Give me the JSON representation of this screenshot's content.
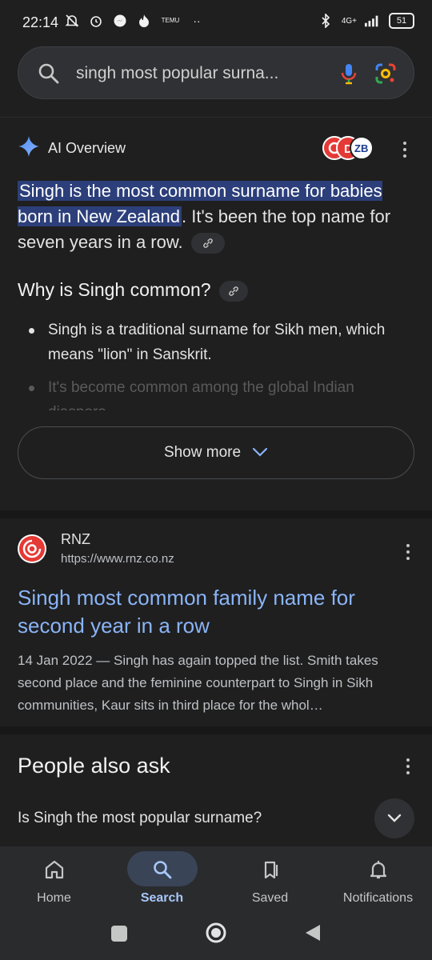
{
  "status_bar": {
    "time": "22:14",
    "temu_label": "TEMU",
    "network": "4G+",
    "battery": "51"
  },
  "search": {
    "query": "singh most popular surna..."
  },
  "ai_overview": {
    "title": "AI Overview",
    "highlighted_text": "Singh is the most common surname for babies born in New Zealand",
    "rest_text": ". It's been the top name for seven years in a row.",
    "heading": "Why is Singh common?",
    "bullets": [
      "Singh is a traditional surname for Sikh men, which means \"lion\" in Sanskrit.",
      "It's become common among the global Indian diaspora."
    ],
    "show_more": "Show more",
    "source_logos": [
      "RNZ",
      "D",
      "ZB"
    ]
  },
  "result": {
    "site_name": "RNZ",
    "url": "https://www.rnz.co.nz",
    "title": "Singh most common family name for second year in a row",
    "snippet": "14 Jan 2022 — Singh has again topped the list. Smith takes second place and the feminine counterpart to Singh in Sikh communities, Kaur sits in third place for the whol…"
  },
  "people_also_ask": {
    "heading": "People also ask",
    "question": "Is Singh the most popular surname?"
  },
  "bottom_nav": {
    "items": [
      {
        "label": "Home",
        "icon": "home-icon"
      },
      {
        "label": "Search",
        "icon": "search-icon",
        "active": true
      },
      {
        "label": "Saved",
        "icon": "bookmarks-icon"
      },
      {
        "label": "Notifications",
        "icon": "bell-icon"
      }
    ]
  },
  "colors": {
    "background": "#1f1f1f",
    "link": "#8ab4f8",
    "highlight": "#2c3f7a",
    "active_nav": "#a8c7fa"
  }
}
